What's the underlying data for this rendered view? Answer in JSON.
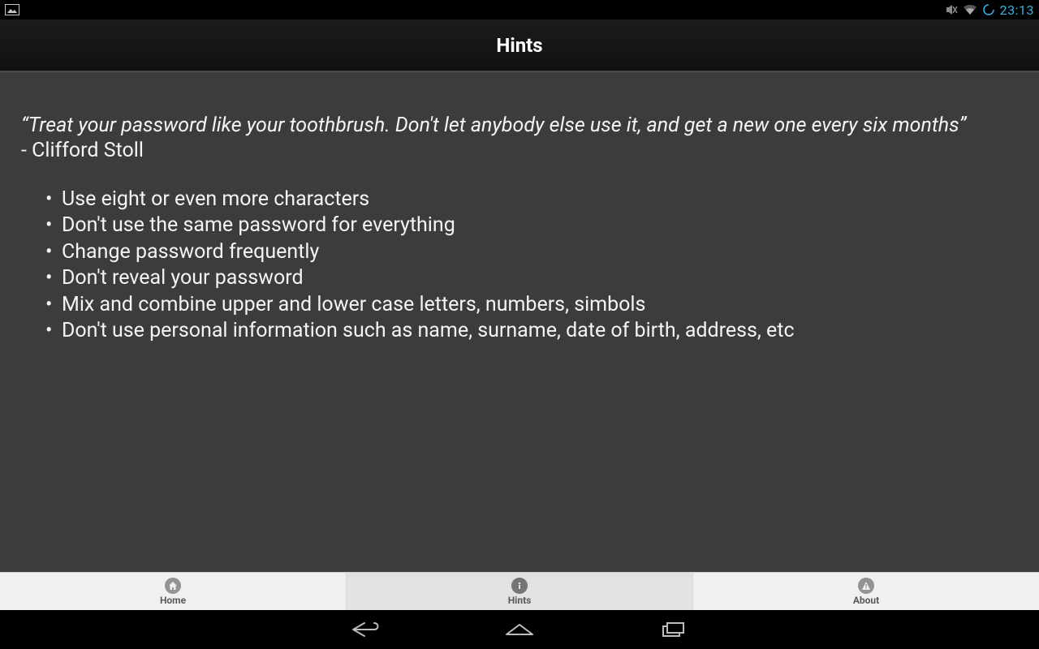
{
  "status_bar": {
    "clock": "23:13"
  },
  "app_bar": {
    "title": "Hints"
  },
  "content": {
    "quote_text": "“Treat your password like your toothbrush. Don't let anybody else use it, and get a new one every six months”",
    "quote_author": "- Clifford Stoll",
    "hints": [
      "Use eight or even more characters",
      "Don't use the same password for everything",
      "Change password frequently",
      "Don't reveal your password",
      "Mix and combine upper and lower case letters, numbers, simbols",
      "Don't use personal information such as name, surname, date of birth, address, etc"
    ]
  },
  "tabs": {
    "home": {
      "label": "Home"
    },
    "hints": {
      "label": "Hints"
    },
    "about": {
      "label": "About"
    }
  }
}
